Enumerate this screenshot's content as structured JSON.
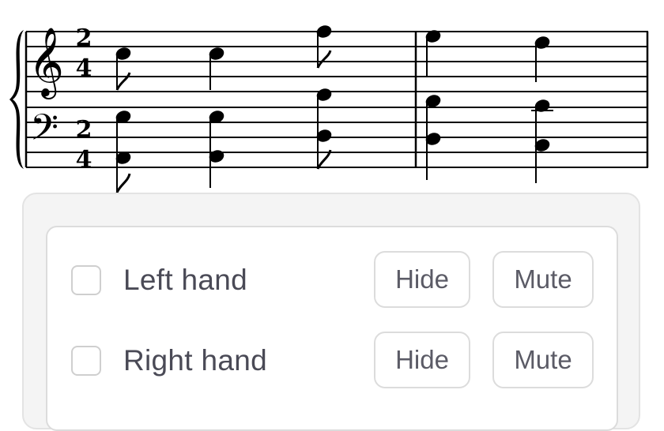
{
  "score": {
    "treble_time_signature": {
      "top": "2",
      "bottom": "4"
    },
    "bass_time_signature": {
      "top": "2",
      "bottom": "4"
    }
  },
  "tracks": [
    {
      "label": "Left hand",
      "hide_label": "Hide",
      "mute_label": "Mute"
    },
    {
      "label": "Right hand",
      "hide_label": "Hide",
      "mute_label": "Mute"
    }
  ]
}
